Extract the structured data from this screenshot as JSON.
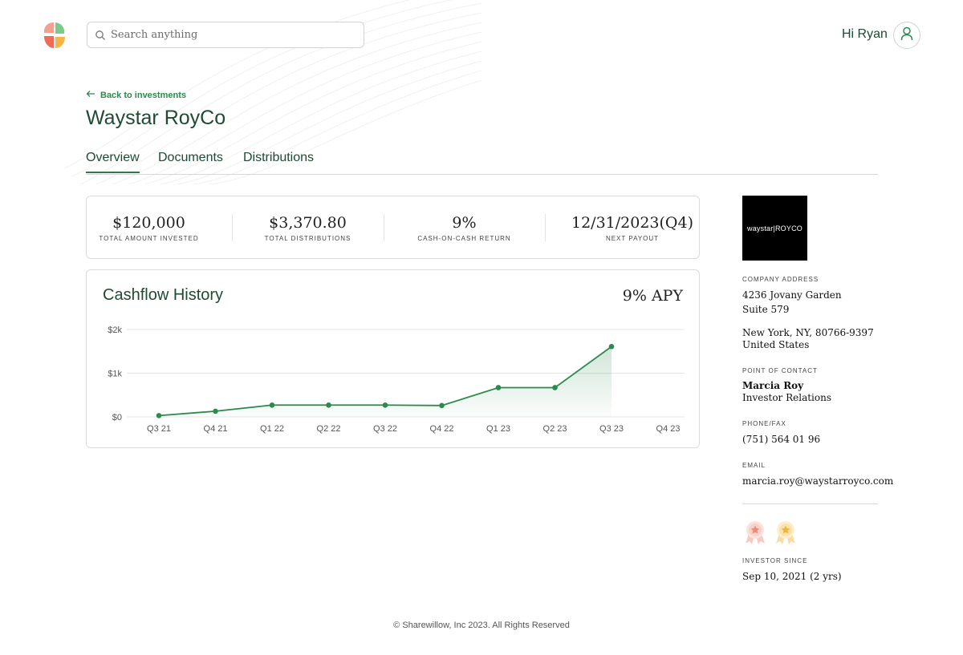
{
  "app": {
    "brand_colors": {
      "accent": "#2d8a4e",
      "dark_green": "#1f4a34"
    }
  },
  "header": {
    "search": {
      "placeholder": "Search anything",
      "icon": "search-icon"
    },
    "greeting": "Hi Ryan",
    "avatar_icon": "user-icon"
  },
  "nav": {
    "back_label": "Back to investments"
  },
  "investment": {
    "title": "Waystar RoyCo"
  },
  "tabs": [
    {
      "label": "Overview",
      "active": true
    },
    {
      "label": "Documents",
      "active": false
    },
    {
      "label": "Distributions",
      "active": false
    }
  ],
  "stats": [
    {
      "value": "$120,000",
      "label": "TOTAL AMOUNT INVESTED"
    },
    {
      "value": "$3,370.80",
      "label": "TOTAL DISTRIBUTIONS"
    },
    {
      "value": "9%",
      "label": "CASH-ON-CASH RETURN"
    },
    {
      "value": "12/31/2023(Q4)",
      "label": "NEXT PAYOUT"
    }
  ],
  "cashflow": {
    "title": "Cashflow History",
    "apy": "9% APY"
  },
  "chart_data": {
    "type": "area",
    "categories": [
      "Q3 21",
      "Q4 21",
      "Q1 22",
      "Q2 22",
      "Q3 22",
      "Q4 22",
      "Q1 23",
      "Q2 23",
      "Q3 23",
      "Q4 23"
    ],
    "values": [
      30,
      130,
      270,
      270,
      270,
      260,
      670,
      670,
      1610,
      null
    ],
    "ylim": [
      0,
      2000
    ],
    "yticks": [
      0,
      1000,
      2000
    ],
    "ytick_labels": [
      "$0",
      "$1k",
      "$2k"
    ],
    "grid": true,
    "line_color": "#2d8a4e"
  },
  "company": {
    "logo_text": "waystar|ROYCO",
    "address_label": "COMPANY ADDRESS",
    "address_line1": "4236 Jovany Garden",
    "address_line2": "Suite 579",
    "address_line3": "New York, NY, 80766-9397",
    "address_line4": "United States",
    "contact_label": "POINT OF CONTACT",
    "contact_name": "Marcia Roy",
    "contact_role": "Investor Relations",
    "phone_label": "PHONE/FAX",
    "phone": "(751) 564 01 96",
    "email_label": "EMAIL",
    "email": "marcia.roy@waystarroyco.com",
    "badges": [
      "ribbon-badge-rose-icon",
      "ribbon-badge-gold-icon"
    ],
    "investor_since_label": "INVESTOR SINCE",
    "investor_since": "Sep 10, 2021 (2 yrs)"
  },
  "footer": {
    "text": "© Sharewillow, Inc 2023. All Rights Reserved"
  }
}
